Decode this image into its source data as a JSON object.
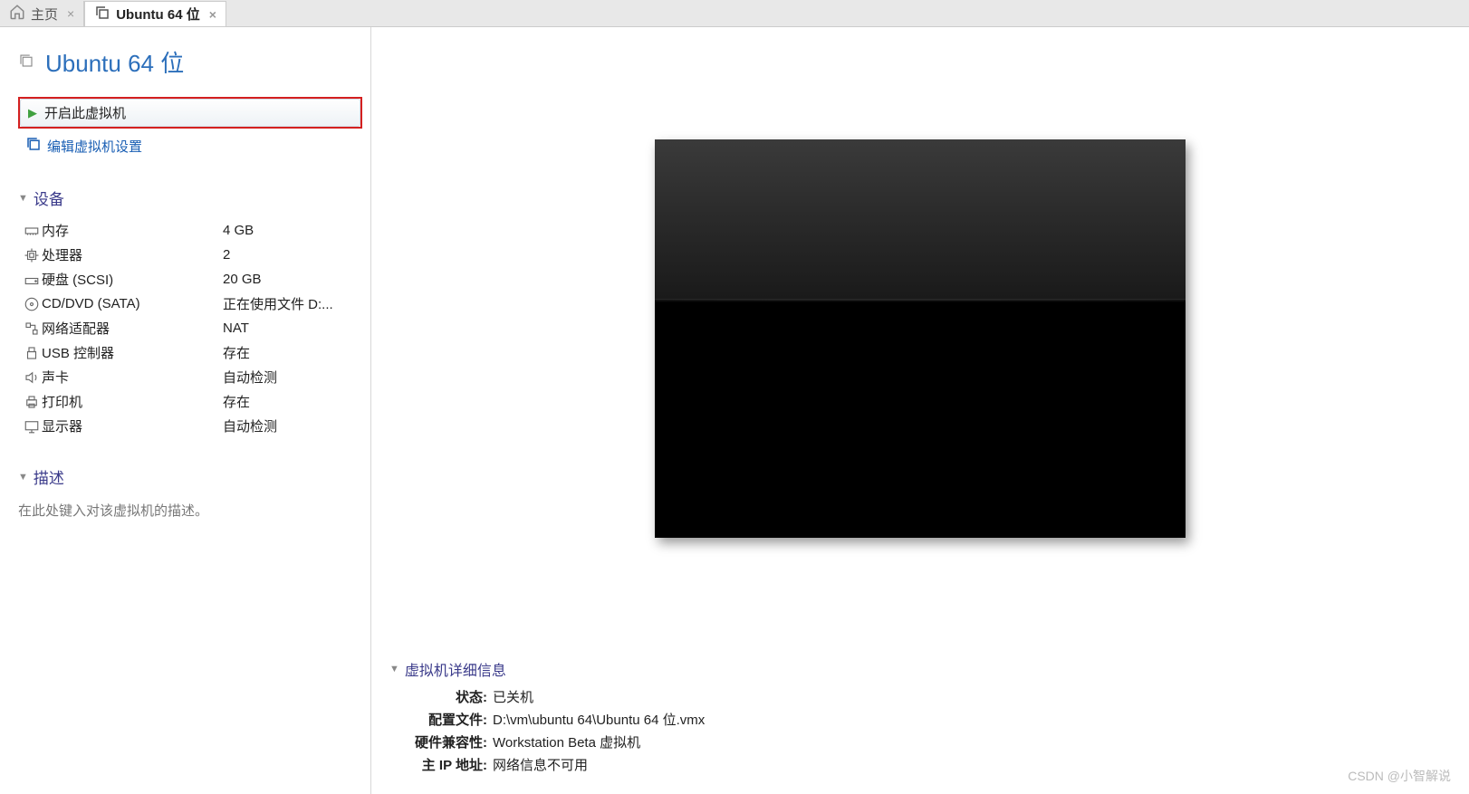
{
  "tabs": {
    "home": "主页",
    "vm": "Ubuntu 64 位"
  },
  "vm_title": "Ubuntu 64 位",
  "actions": {
    "power_on": "开启此虚拟机",
    "edit_settings": "编辑虚拟机设置"
  },
  "sections": {
    "devices": "设备",
    "description": "描述",
    "details": "虚拟机详细信息"
  },
  "devices": {
    "memory": {
      "label": "内存",
      "value": "4 GB"
    },
    "processor": {
      "label": "处理器",
      "value": "2"
    },
    "hdd": {
      "label": "硬盘 (SCSI)",
      "value": "20 GB"
    },
    "cddvd": {
      "label": "CD/DVD (SATA)",
      "value": "正在使用文件 D:..."
    },
    "network": {
      "label": "网络适配器",
      "value": "NAT"
    },
    "usb": {
      "label": "USB 控制器",
      "value": "存在"
    },
    "sound": {
      "label": "声卡",
      "value": "自动检测"
    },
    "printer": {
      "label": "打印机",
      "value": "存在"
    },
    "display": {
      "label": "显示器",
      "value": "自动检测"
    }
  },
  "description_placeholder": "在此处键入对该虚拟机的描述。",
  "details": {
    "state": {
      "label": "状态:",
      "value": "已关机"
    },
    "config": {
      "label": "配置文件:",
      "value": "D:\\vm\\ubuntu 64\\Ubuntu 64 位.vmx"
    },
    "compat": {
      "label": "硬件兼容性:",
      "value": "Workstation Beta 虚拟机"
    },
    "ip": {
      "label": "主 IP 地址:",
      "value": "网络信息不可用"
    }
  },
  "watermark": "CSDN @小智解说"
}
